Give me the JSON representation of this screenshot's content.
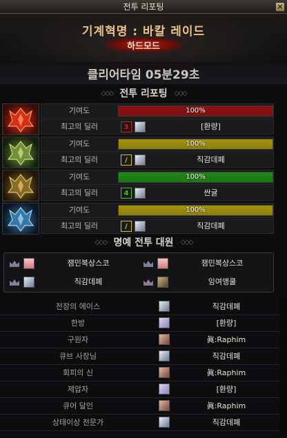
{
  "window": {
    "title": "전투 리포팅",
    "close_label": "×"
  },
  "header": {
    "raid_name": "기계혁명 : 바칼 레이드",
    "mode": "하드모드"
  },
  "clear_time": "클리어타임  05분29초",
  "sections": {
    "report": "전투 리포팅",
    "honor": "명예 전투 대원",
    "deco_left": "◇◇◇",
    "deco_right": "◇◇◇"
  },
  "labels": {
    "contribution": "기여도",
    "best_dealer": "최고의 딜러"
  },
  "bosses": [
    {
      "icon": "red-dragon-boss-icon",
      "contribution": "100%",
      "fill": 1.0,
      "bar_color": "#8f0f0f",
      "dealer_rank": "3",
      "rank_color": "#d21a1a",
      "dealer": "[환량]"
    },
    {
      "icon": "green-dragon-boss-icon",
      "contribution": "100%",
      "fill": 1.0,
      "bar_color": "#a5940a",
      "dealer_rank": "/",
      "rank_color": "#d6c41e",
      "dealer": "직감데폐"
    },
    {
      "icon": "gold-dragon-boss-icon",
      "contribution": "100%",
      "fill": 1.0,
      "bar_color": "#1e8a14",
      "dealer_rank": "4",
      "rank_color": "#3cc02a",
      "dealer": "싼귤"
    },
    {
      "icon": "blue-dragon-boss-icon",
      "contribution": "100%",
      "fill": 1.0,
      "bar_color": "#a5940a",
      "dealer_rank": "/",
      "rank_color": "#d6c41e",
      "dealer": "직감데폐"
    }
  ],
  "honor": [
    {
      "name": "잼민복상스코"
    },
    {
      "name": "잼민복상스코"
    },
    {
      "name": "직감데폐"
    },
    {
      "name": "잉여앵쿨"
    }
  ],
  "awards": [
    {
      "title": "전장의 에이스",
      "name": "직감데폐"
    },
    {
      "title": "한방",
      "name": "[환량]"
    },
    {
      "title": "구원자",
      "name": "眞:Raphim"
    },
    {
      "title": "큐브 사장님",
      "name": "직감데폐"
    },
    {
      "title": "회피의 신",
      "name": "眞:Raphim"
    },
    {
      "title": "제압자",
      "name": "[환량]"
    },
    {
      "title": "큐어 달인",
      "name": "眞:Raphim"
    },
    {
      "title": "상태이상 전문가",
      "name": "직감데폐"
    }
  ]
}
